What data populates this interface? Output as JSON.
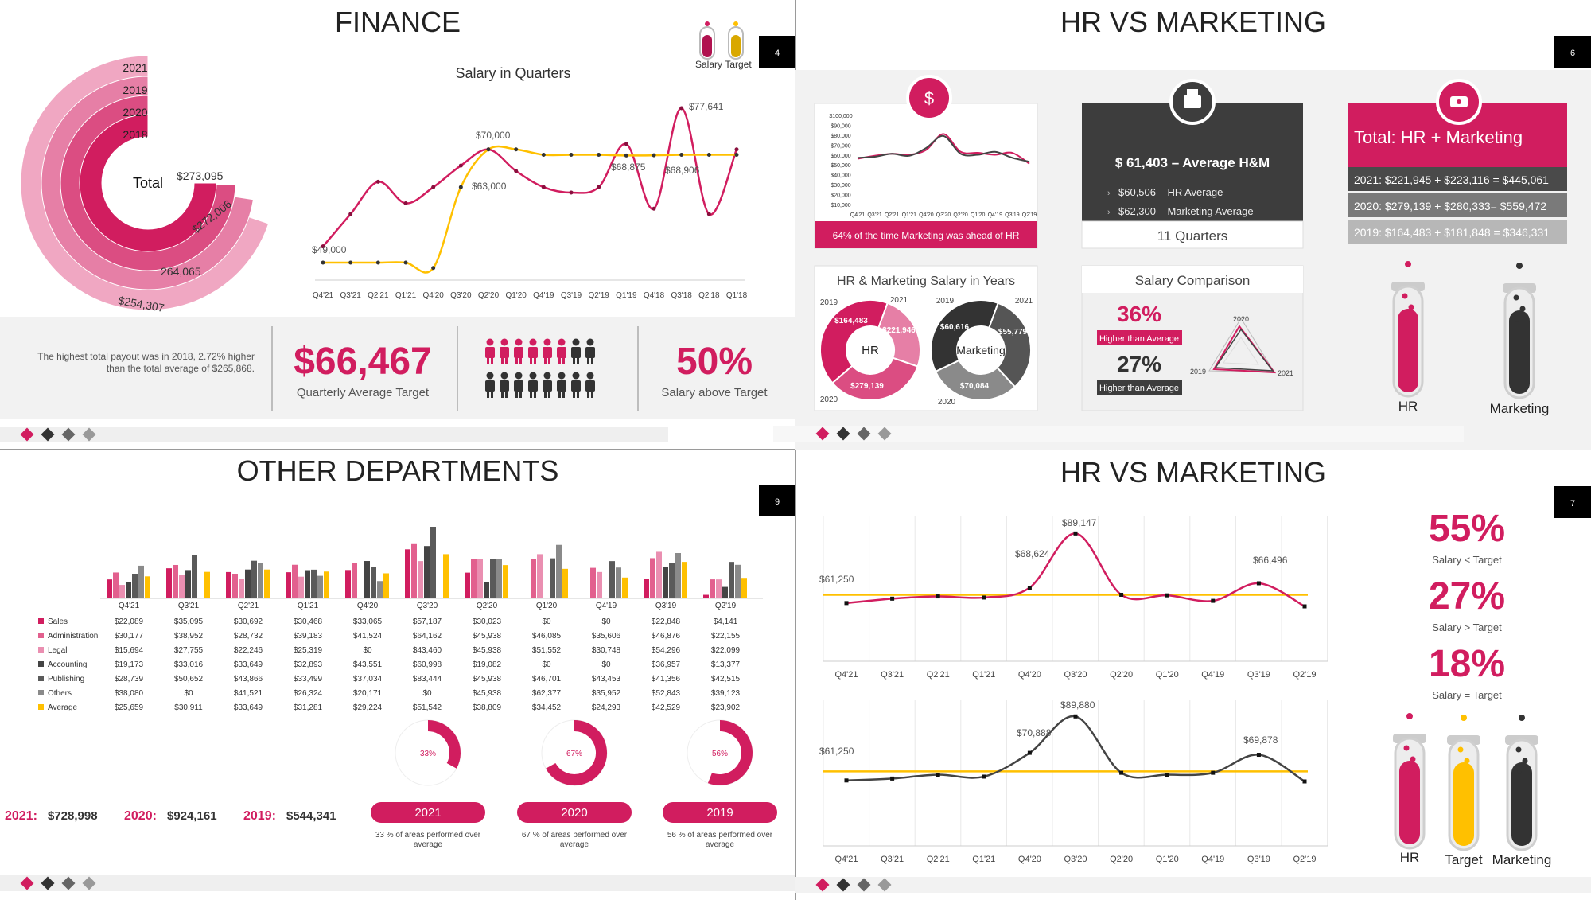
{
  "finance": {
    "title": "FINANCE",
    "slide_number": "4",
    "legend": {
      "salary": "Salary",
      "target": "Target"
    },
    "arc_years": [
      "2021",
      "2019",
      "2020",
      "2018"
    ],
    "arc_center": "Total",
    "arc_values": [
      "$273,095",
      "$272,006",
      "264,065",
      "$254,307"
    ],
    "chart_title": "Salary in Quarters",
    "summary_text": [
      "The highest total payout was in 2018, 2.72% higher",
      "than the total average of $265,868."
    ],
    "kpi_big": "$66,467",
    "kpi_big_caption": "Quarterly Average Target",
    "kpi_pct": "50%",
    "kpi_pct_caption": "Salary above Target"
  },
  "hr_marketing_a": {
    "title": "HR VS MARKETING",
    "slide_number": "6",
    "mini_chart_note": "64% of the time Marketing was ahead of HR",
    "avg_title": "$ 61,403 – Average H&M",
    "avg_bullets": [
      "$60,506 – HR Average",
      "$62,300 – Marketing Average"
    ],
    "avg_footer": "11 Quarters",
    "total_title": "Total: HR + Marketing",
    "total_rows": [
      "2021: $221,945 + $223,116 = $445,061",
      "2020: $279,139 + $280,333= $559,472",
      "2019: $164,483 + $181,848 = $346,331"
    ],
    "donut_panel_title": "HR & Marketing Salary in Years",
    "donut_hr_center": "HR",
    "donut_mk_center": "Marketing",
    "donut_year_labels": [
      "2019",
      "2021",
      "2020"
    ],
    "donut_hr_values": [
      "$164,483",
      "$221,946",
      "$279,139"
    ],
    "donut_mk_values": [
      "$60,616",
      "$55,779",
      "$70,084"
    ],
    "comparison_title": "Salary Comparison",
    "comparison_pct1": "36%",
    "comparison_label1": "Higher than Average",
    "comparison_pct2": "27%",
    "comparison_label2": "Higher than Average",
    "radar_labels": [
      "2020",
      "2019",
      "2021"
    ],
    "tube_labels": [
      "HR",
      "Marketing"
    ]
  },
  "other_departments": {
    "title": "OTHER DEPARTMENTS",
    "slide_number": "9",
    "year_totals": [
      {
        "year": "2021:",
        "value": "$728,998"
      },
      {
        "year": "2020:",
        "value": "$924,161"
      },
      {
        "year": "2019:",
        "value": "$544,341"
      }
    ],
    "gauges": [
      {
        "pct": "33%",
        "year": "2021",
        "caption": [
          "33 % of areas performed over",
          "average"
        ]
      },
      {
        "pct": "67%",
        "year": "2020",
        "caption": [
          "67 % of areas performed over",
          "average"
        ]
      },
      {
        "pct": "56%",
        "year": "2019",
        "caption": [
          "56 % of areas performed over",
          "average"
        ]
      }
    ]
  },
  "hr_marketing_b": {
    "title": "HR VS MARKETING",
    "slide_number": "7",
    "stats": [
      {
        "pct": "55%",
        "label": "Salary < Target"
      },
      {
        "pct": "27%",
        "label": "Salary > Target"
      },
      {
        "pct": "18%",
        "label": "Salary = Target"
      }
    ],
    "tube_labels": [
      "HR",
      "Target",
      "Marketing"
    ]
  },
  "colors": {
    "pink": "#d11d5f",
    "pink2": "#e2608e",
    "pink3": "#ea8fb1",
    "dark": "#3b3b3b",
    "gray": "#8a8a8a",
    "yellow": "#ffc000",
    "panel": "#f2f2f2"
  },
  "chart_data": [
    {
      "type": "line",
      "title": "Salary in Quarters",
      "categories": [
        "Q4'21",
        "Q3'21",
        "Q2'21",
        "Q1'21",
        "Q4'20",
        "Q3'20",
        "Q2'20",
        "Q1'20",
        "Q4'19",
        "Q3'19",
        "Q2'19",
        "Q1'19",
        "Q4'18",
        "Q3'18",
        "Q2'18",
        "Q1'18"
      ],
      "series": [
        {
          "name": "Salary",
          "values": [
            52000,
            58000,
            64000,
            60000,
            63000,
            67000,
            70000,
            66000,
            63000,
            62000,
            63000,
            71000,
            59000,
            77641,
            58000,
            70000
          ]
        },
        {
          "name": "Target",
          "values": [
            49000,
            49000,
            49000,
            49000,
            48000,
            63000,
            70000,
            70000,
            69000,
            69000,
            69000,
            68875,
            68906,
            69000,
            69000,
            69000
          ]
        }
      ],
      "data_labels": [
        "$77,641",
        "$70,000",
        "$63,000",
        "$68,875",
        "$68,906",
        "$49,000"
      ]
    },
    {
      "type": "pie",
      "title": "Total",
      "categories": [
        "2018",
        "2020",
        "2019",
        "2021"
      ],
      "values": [
        273095,
        272006,
        264065,
        254307
      ]
    },
    {
      "type": "line",
      "categories": [
        "Q4'21",
        "Q3'21",
        "Q2'21",
        "Q1'21",
        "Q4'20",
        "Q3'20",
        "Q2'20",
        "Q1'20",
        "Q4'19",
        "Q3'19",
        "Q2'19"
      ],
      "yticks": [
        "$100,000",
        "$90,000",
        "$80,000",
        "$70,000",
        "$60,000",
        "$50,000",
        "$40,000",
        "$30,000",
        "$20,000",
        "$10,000"
      ],
      "ylim": [
        10000,
        100000
      ],
      "series": [
        {
          "name": "HR",
          "values": [
            57000,
            60000,
            62000,
            61000,
            66000,
            82000,
            64000,
            63000,
            61000,
            63000,
            52000
          ]
        },
        {
          "name": "Marketing",
          "values": [
            58000,
            59000,
            62000,
            60000,
            68000,
            80000,
            62000,
            61000,
            64000,
            58000,
            54000
          ]
        }
      ]
    },
    {
      "type": "bar",
      "categories": [
        "Q4'21",
        "Q3'21",
        "Q2'21",
        "Q1'21",
        "Q4'20",
        "Q3'20",
        "Q2'20",
        "Q1'20",
        "Q4'19",
        "Q3'19",
        "Q2'19"
      ],
      "series": [
        {
          "name": "Sales",
          "values": [
            22089,
            35095,
            30692,
            30468,
            33065,
            57187,
            30023,
            0,
            0,
            22848,
            4141
          ]
        },
        {
          "name": "Administration",
          "values": [
            30177,
            38952,
            28732,
            39183,
            41524,
            64162,
            45938,
            46085,
            35606,
            46876,
            22155
          ]
        },
        {
          "name": "Legal",
          "values": [
            15694,
            27755,
            22246,
            25319,
            0,
            43460,
            45938,
            51552,
            30748,
            54296,
            22099
          ]
        },
        {
          "name": "Accounting",
          "values": [
            19173,
            33016,
            33649,
            32893,
            43551,
            60998,
            19082,
            0,
            0,
            36957,
            13377
          ]
        },
        {
          "name": "Publishing",
          "values": [
            28739,
            50652,
            43866,
            33499,
            37034,
            83444,
            45938,
            46701,
            43453,
            41356,
            42515
          ]
        },
        {
          "name": "Others",
          "values": [
            38080,
            0,
            41521,
            26324,
            20171,
            0,
            45938,
            62377,
            35952,
            52843,
            39123
          ]
        },
        {
          "name": "Average",
          "values": [
            25659,
            30911,
            33649,
            31281,
            29224,
            51542,
            38809,
            34452,
            24293,
            42529,
            23902
          ]
        }
      ],
      "table_values": {
        "Sales": [
          "$22,089",
          "$35,095",
          "$30,692",
          "$30,468",
          "$33,065",
          "$57,187",
          "$30,023",
          "$0",
          "$0",
          "$22,848",
          "$4,141"
        ],
        "Administration": [
          "$30,177",
          "$38,952",
          "$28,732",
          "$39,183",
          "$41,524",
          "$64,162",
          "$45,938",
          "$46,085",
          "$35,606",
          "$46,876",
          "$22,155"
        ],
        "Legal": [
          "$15,694",
          "$27,755",
          "$22,246",
          "$25,319",
          "$0",
          "$43,460",
          "$45,938",
          "$51,552",
          "$30,748",
          "$54,296",
          "$22,099"
        ],
        "Accounting": [
          "$19,173",
          "$33,016",
          "$33,649",
          "$32,893",
          "$43,551",
          "$60,998",
          "$19,082",
          "$0",
          "$0",
          "$36,957",
          "$13,377"
        ],
        "Publishing": [
          "$28,739",
          "$50,652",
          "$43,866",
          "$33,499",
          "$37,034",
          "$83,444",
          "$45,938",
          "$46,701",
          "$43,453",
          "$41,356",
          "$42,515"
        ],
        "Others": [
          "$38,080",
          "$0",
          "$41,521",
          "$26,324",
          "$20,171",
          "$0",
          "$45,938",
          "$62,377",
          "$35,952",
          "$52,843",
          "$39,123"
        ],
        "Average": [
          "$25,659",
          "$30,911",
          "$33,649",
          "$31,281",
          "$29,224",
          "$51,542",
          "$38,809",
          "$34,452",
          "$24,293",
          "$42,529",
          "$23,902"
        ]
      }
    },
    {
      "type": "line",
      "categories": [
        "Q4'21",
        "Q3'21",
        "Q2'21",
        "Q1'21",
        "Q4'20",
        "Q3'20",
        "Q2'20",
        "Q1'20",
        "Q4'19",
        "Q3'19",
        "Q2'19"
      ],
      "series": [
        {
          "name": "HR",
          "values": [
            57500,
            59500,
            60500,
            60000,
            64500,
            89147,
            61250,
            61000,
            58500,
            66496,
            56000
          ]
        },
        {
          "name": "Target",
          "values": [
            61250,
            61250,
            61250,
            61250,
            61250,
            61250,
            61250,
            61250,
            61250,
            61250,
            61250
          ]
        }
      ],
      "data_labels": [
        "$61,250",
        "$68,624",
        "$89,147",
        "$66,496"
      ]
    },
    {
      "type": "line",
      "categories": [
        "Q4'21",
        "Q3'21",
        "Q2'21",
        "Q1'21",
        "Q4'20",
        "Q3'20",
        "Q2'20",
        "Q1'20",
        "Q4'19",
        "Q3'19",
        "Q2'19"
      ],
      "series": [
        {
          "name": "Marketing",
          "values": [
            56500,
            57500,
            59500,
            58500,
            70888,
            89880,
            60500,
            59500,
            60500,
            69878,
            56000
          ]
        },
        {
          "name": "Target",
          "values": [
            61250,
            61250,
            61250,
            61250,
            61250,
            61250,
            61250,
            61250,
            61250,
            61250,
            61250
          ]
        }
      ],
      "data_labels": [
        "$61,250",
        "$70,888",
        "$89,880",
        "$69,878"
      ]
    }
  ]
}
